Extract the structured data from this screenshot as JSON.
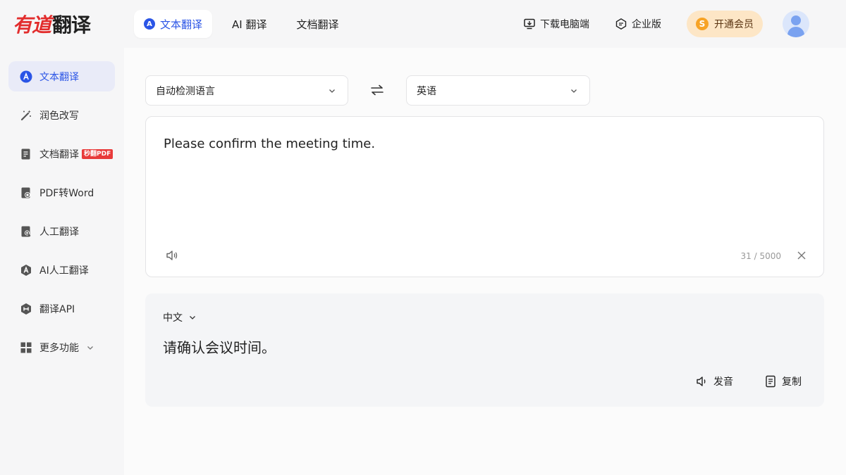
{
  "brand": {
    "logo_red": "有道",
    "logo_dark": "翻译"
  },
  "top_nav": {
    "tabs": [
      {
        "label": "文本翻译",
        "active": true
      },
      {
        "label": "AI 翻译",
        "active": false
      },
      {
        "label": "文档翻译",
        "active": false
      }
    ],
    "tab_badge": "A",
    "download": "下载电脑端",
    "enterprise": "企业版",
    "vip": "开通会员",
    "vip_coin": "S"
  },
  "sidebar": {
    "items": [
      {
        "label": "文本翻译",
        "icon": "translate-a-icon",
        "active": true
      },
      {
        "label": "润色改写",
        "icon": "magic-wand-icon"
      },
      {
        "label": "文档翻译",
        "icon": "document-icon",
        "badge": "秒翻PDF"
      },
      {
        "label": "PDF转Word",
        "icon": "pdf-convert-icon"
      },
      {
        "label": "人工翻译",
        "icon": "human-translate-icon"
      },
      {
        "label": "AI人工翻译",
        "icon": "ai-translate-icon"
      },
      {
        "label": "翻译API",
        "icon": "api-icon"
      },
      {
        "label": "更多功能",
        "icon": "grid-icon"
      }
    ],
    "translate_badge": "A"
  },
  "translator": {
    "source_lang": "自动检测语言",
    "target_lang": "英语",
    "input_text": "Please confirm the meeting time.",
    "char_count": "31 / 5000",
    "output_lang": "中文",
    "output_text": "请确认会议时间。",
    "pronounce_label": "发音",
    "copy_label": "复制"
  },
  "colors": {
    "accent": "#2b55e6",
    "brand_red": "#e22d2d",
    "vip_bg": "#fde6c6",
    "badge_red": "#e83a3a"
  }
}
